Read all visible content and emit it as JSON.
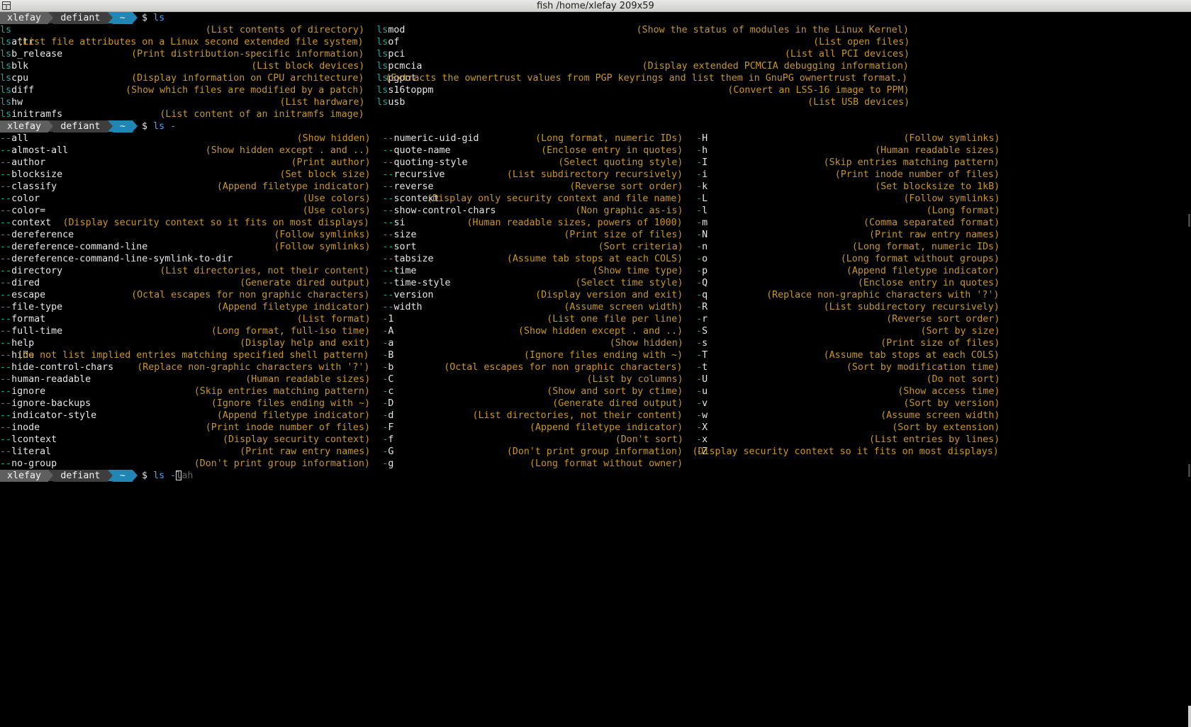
{
  "window": {
    "title": "fish  /home/xlefay 209x59"
  },
  "prompt": {
    "user": "xlefay",
    "host": "defiant",
    "dir": "~",
    "symbol": "$"
  },
  "commands": [
    {
      "text": "ls"
    },
    {
      "text": "ls -"
    },
    {
      "typed": "ls -",
      "cursor_char": "l",
      "suggestion": "ah"
    }
  ],
  "ls_completions": {
    "prefix": "ls",
    "left": [
      {
        "rest": "",
        "desc": "(List contents of directory)"
      },
      {
        "rest": "attr",
        "desc": "(List file attributes on a Linux second extended file system)"
      },
      {
        "rest": "b_release",
        "desc": "(Print distribution-specific information)"
      },
      {
        "rest": "blk",
        "desc": "(List block devices)"
      },
      {
        "rest": "cpu",
        "desc": "(Display information on CPU architecture)"
      },
      {
        "rest": "diff",
        "desc": "(Show which files are modified by a patch)"
      },
      {
        "rest": "hw",
        "desc": "(List hardware)"
      },
      {
        "rest": "initramfs",
        "desc": "(List content of an initramfs image)"
      }
    ],
    "right": [
      {
        "rest": "mod",
        "desc": "(Show the status of modules in the Linux Kernel)"
      },
      {
        "rest": "of",
        "desc": "(List open files)"
      },
      {
        "rest": "pci",
        "desc": "(List all PCI devices)"
      },
      {
        "rest": "pcmcia",
        "desc": "(Display extended PCMCIA debugging information)"
      },
      {
        "rest": "pgpot",
        "desc": "(Extracts the ownertrust values from PGP keyrings and list them in GnuPG ownertrust format.)"
      },
      {
        "rest": "s16toppm",
        "desc": "(Convert an LSS-16 image to PPM)"
      },
      {
        "rest": "usb",
        "desc": "(List USB devices)"
      }
    ]
  },
  "flag_completions": {
    "col1": [
      {
        "m": "--",
        "r": "all",
        "d": "(Show hidden)"
      },
      {
        "m": "--",
        "r": "almost-all",
        "d": "(Show hidden except . and ..)"
      },
      {
        "m": "--",
        "r": "author",
        "d": "(Print author)"
      },
      {
        "m": "--",
        "r": "blocksize",
        "d": "(Set block size)"
      },
      {
        "m": "--",
        "r": "classify",
        "d": "(Append filetype indicator)"
      },
      {
        "m": "--",
        "r": "color",
        "d": "(Use colors)"
      },
      {
        "m": "--",
        "r": "color=",
        "d": "(Use colors)"
      },
      {
        "m": "--",
        "r": "context",
        "d": "(Display security context so it fits on most displays)"
      },
      {
        "m": "--",
        "r": "dereference",
        "d": "(Follow symlinks)"
      },
      {
        "m": "--",
        "r": "dereference-command-line",
        "d": "(Follow symlinks)"
      },
      {
        "m": "--",
        "r": "dereference-command-line-symlink-to-dir",
        "d": ""
      },
      {
        "m": "--",
        "r": "directory",
        "d": "(List directories, not their content)"
      },
      {
        "m": "--",
        "r": "dired",
        "d": "(Generate dired output)"
      },
      {
        "m": "--",
        "r": "escape",
        "d": "(Octal escapes for non graphic characters)"
      },
      {
        "m": "--",
        "r": "file-type",
        "d": "(Append filetype indicator)"
      },
      {
        "m": "--",
        "r": "format",
        "d": "(List format)"
      },
      {
        "m": "--",
        "r": "full-time",
        "d": "(Long format, full-iso time)"
      },
      {
        "m": "--",
        "r": "help",
        "d": "(Display help and exit)"
      },
      {
        "m": "--",
        "r": "hide",
        "d": "(Do not list implied entries matching specified shell pattern)"
      },
      {
        "m": "--",
        "r": "hide-control-chars",
        "d": "(Replace non-graphic characters with '?')"
      },
      {
        "m": "--",
        "r": "human-readable",
        "d": "(Human readable sizes)"
      },
      {
        "m": "--",
        "r": "ignore",
        "d": "(Skip entries matching pattern)"
      },
      {
        "m": "--",
        "r": "ignore-backups",
        "d": "(Ignore files ending with ~)"
      },
      {
        "m": "--",
        "r": "indicator-style",
        "d": "(Append filetype indicator)"
      },
      {
        "m": "--",
        "r": "inode",
        "d": "(Print inode number of files)"
      },
      {
        "m": "--",
        "r": "lcontext",
        "d": "(Display security context)"
      },
      {
        "m": "--",
        "r": "literal",
        "d": "(Print raw entry names)"
      },
      {
        "m": "--",
        "r": "no-group",
        "d": "(Don't print group information)"
      }
    ],
    "col2": [
      {
        "m": "--",
        "r": "numeric-uid-gid",
        "d": "(Long format, numeric IDs)"
      },
      {
        "m": "--",
        "r": "quote-name",
        "d": "(Enclose entry in quotes)"
      },
      {
        "m": "--",
        "r": "quoting-style",
        "d": "(Select quoting style)"
      },
      {
        "m": "--",
        "r": "recursive",
        "d": "(List subdirectory recursively)"
      },
      {
        "m": "--",
        "r": "reverse",
        "d": "(Reverse sort order)"
      },
      {
        "m": "--",
        "r": "scontext",
        "d": "(Display only security context and file name)"
      },
      {
        "m": "--",
        "r": "show-control-chars",
        "d": "(Non graphic as-is)"
      },
      {
        "m": "--",
        "r": "si",
        "d": "(Human readable sizes, powers of 1000)"
      },
      {
        "m": "--",
        "r": "size",
        "d": "(Print size of files)"
      },
      {
        "m": "--",
        "r": "sort",
        "d": "(Sort criteria)"
      },
      {
        "m": "--",
        "r": "tabsize",
        "d": "(Assume tab stops at each COLS)"
      },
      {
        "m": "--",
        "r": "time",
        "d": "(Show time type)"
      },
      {
        "m": "--",
        "r": "time-style",
        "d": "(Select time style)"
      },
      {
        "m": "--",
        "r": "version",
        "d": "(Display version and exit)"
      },
      {
        "m": "--",
        "r": "width",
        "d": "(Assume screen width)"
      },
      {
        "m": "-",
        "r": "1",
        "d": "(List one file per line)"
      },
      {
        "m": "-",
        "r": "A",
        "d": "(Show hidden except . and ..)"
      },
      {
        "m": "-",
        "r": "a",
        "d": "(Show hidden)"
      },
      {
        "m": "-",
        "r": "B",
        "d": "(Ignore files ending with ~)"
      },
      {
        "m": "-",
        "r": "b",
        "d": "(Octal escapes for non graphic characters)"
      },
      {
        "m": "-",
        "r": "C",
        "d": "(List by columns)"
      },
      {
        "m": "-",
        "r": "c",
        "d": "(Show and sort by ctime)"
      },
      {
        "m": "-",
        "r": "D",
        "d": "(Generate dired output)"
      },
      {
        "m": "-",
        "r": "d",
        "d": "(List directories, not their content)"
      },
      {
        "m": "-",
        "r": "F",
        "d": "(Append filetype indicator)"
      },
      {
        "m": "-",
        "r": "f",
        "d": "(Don't sort)"
      },
      {
        "m": "-",
        "r": "G",
        "d": "(Don't print group information)"
      },
      {
        "m": "-",
        "r": "g",
        "d": "(Long format without owner)"
      }
    ],
    "col3": [
      {
        "m": "-",
        "r": "H",
        "d": "(Follow symlinks)"
      },
      {
        "m": "-",
        "r": "h",
        "d": "(Human readable sizes)"
      },
      {
        "m": "-",
        "r": "I",
        "d": "(Skip entries matching pattern)"
      },
      {
        "m": "-",
        "r": "i",
        "d": "(Print inode number of files)"
      },
      {
        "m": "-",
        "r": "k",
        "d": "(Set blocksize to 1kB)"
      },
      {
        "m": "-",
        "r": "L",
        "d": "(Follow symlinks)"
      },
      {
        "m": "-",
        "r": "l",
        "d": "(Long format)"
      },
      {
        "m": "-",
        "r": "m",
        "d": "(Comma separated format)"
      },
      {
        "m": "-",
        "r": "N",
        "d": "(Print raw entry names)"
      },
      {
        "m": "-",
        "r": "n",
        "d": "(Long format, numeric IDs)"
      },
      {
        "m": "-",
        "r": "o",
        "d": "(Long format without groups)"
      },
      {
        "m": "-",
        "r": "p",
        "d": "(Append filetype indicator)"
      },
      {
        "m": "-",
        "r": "Q",
        "d": "(Enclose entry in quotes)"
      },
      {
        "m": "-",
        "r": "q",
        "d": "(Replace non-graphic characters with '?')"
      },
      {
        "m": "-",
        "r": "R",
        "d": "(List subdirectory recursively)"
      },
      {
        "m": "-",
        "r": "r",
        "d": "(Reverse sort order)"
      },
      {
        "m": "-",
        "r": "S",
        "d": "(Sort by size)"
      },
      {
        "m": "-",
        "r": "s",
        "d": "(Print size of files)"
      },
      {
        "m": "-",
        "r": "T",
        "d": "(Assume tab stops at each COLS)"
      },
      {
        "m": "-",
        "r": "t",
        "d": "(Sort by modification time)"
      },
      {
        "m": "-",
        "r": "U",
        "d": "(Do not sort)"
      },
      {
        "m": "-",
        "r": "u",
        "d": "(Show access time)"
      },
      {
        "m": "-",
        "r": "v",
        "d": "(Sort by version)"
      },
      {
        "m": "-",
        "r": "w",
        "d": "(Assume screen width)"
      },
      {
        "m": "-",
        "r": "X",
        "d": "(Sort by extension)"
      },
      {
        "m": "-",
        "r": "x",
        "d": "(List entries by lines)"
      },
      {
        "m": "-",
        "r": "Z",
        "d": "(Display security context so it fits on most displays)"
      }
    ]
  },
  "colors": {
    "match": "#2aa198",
    "description": "#c99628",
    "command": "#4aa3ff",
    "prompt_user_bg": "#5f5f5f",
    "prompt_host_bg": "#3e3e3e",
    "prompt_dir_bg": "#1f86b6"
  }
}
